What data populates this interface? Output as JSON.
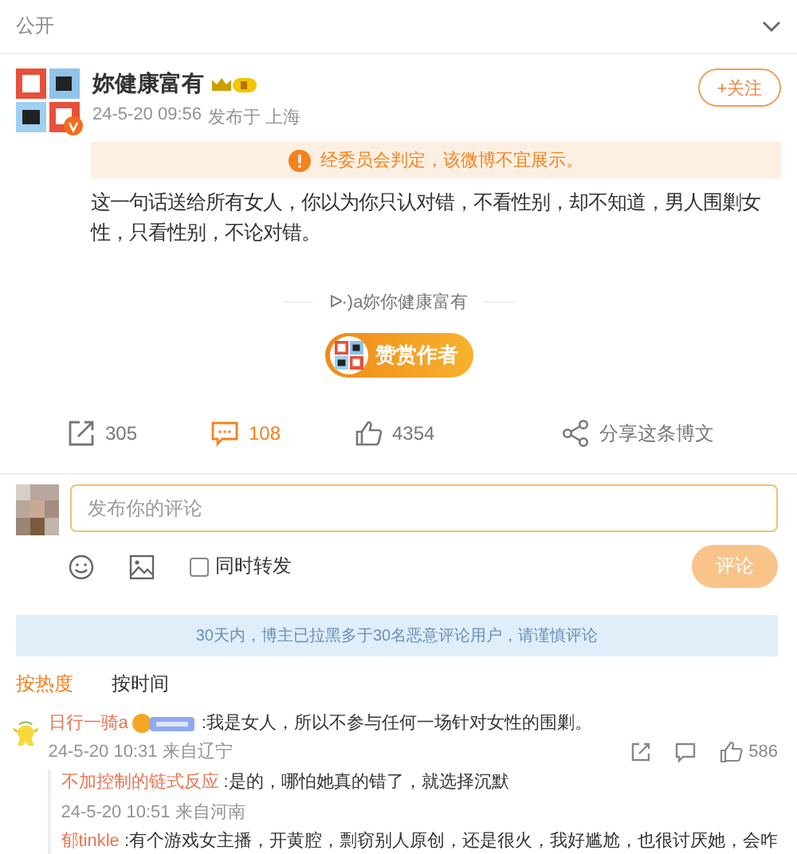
{
  "visibility": "公开",
  "post": {
    "author": "妳健康富有",
    "follow_label": "+关注",
    "date": "24-5-20 09:56",
    "location": "发布于 上海",
    "verified": true,
    "notice": "经委员会判定，该微博不宜展示。",
    "text": "这一句话送给所有女人，你以为你只认对错，不看性别，却不知道，男人围剿女性，只看性别，不论对错。",
    "signature": "ᐅ·)a妳你健康富有",
    "reward_label": "赞赏作者",
    "actions": [
      {
        "kind": "repost",
        "label": "305",
        "selected": false
      },
      {
        "kind": "comment",
        "label": "108",
        "selected": true
      },
      {
        "kind": "like",
        "label": "4354",
        "selected": false
      },
      {
        "kind": "share",
        "label": "分享这条博文",
        "selected": false
      }
    ]
  },
  "comment_box": {
    "placeholder": "发布你的评论",
    "repost_too": {
      "label": "同时转发",
      "checked": false
    },
    "submit": {
      "label": "评论",
      "disabled": true
    }
  },
  "warning": "30天内，博主已拉黑多于30名恶意评论用户，请谨慎评论",
  "sort_tabs": [
    {
      "label": "按热度",
      "selected": true
    },
    {
      "label": "按时间",
      "selected": false
    }
  ],
  "comments": [
    {
      "author": "日行一骑a",
      "text": ":我是女人，所以不参与任何一场针对女性的围剿。",
      "date": "24-5-20 10:31 来自辽宁",
      "likes": "586",
      "replies": [
        {
          "author": "不加控制的链式反应",
          "text": ":是的，哪怕她真的错了，就选择沉默",
          "date": "24-5-20 10:51 来自河南"
        },
        {
          "author": "郁tinkle",
          "text": ":有个游戏女主播，开黄腔，剽窃别人原创，还是很火，我好尴尬，也很讨厌她，会咋"
        }
      ]
    }
  ]
}
